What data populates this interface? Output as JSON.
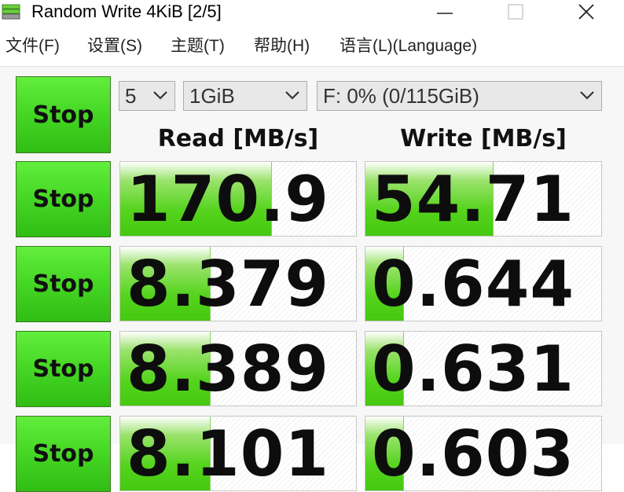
{
  "window": {
    "title": "Random Write 4KiB [2/5]"
  },
  "menu": [
    {
      "label": "文件(F)"
    },
    {
      "label": "设置(S)"
    },
    {
      "label": "主题(T)"
    },
    {
      "label": "帮助(H)"
    },
    {
      "label": "语言(L)(Language)"
    }
  ],
  "controls": {
    "all_label": "Stop",
    "count": "5",
    "size": "1GiB",
    "drive": "F: 0% (0/115GiB)"
  },
  "columns": {
    "read": "Read [MB/s]",
    "write": "Write [MB/s]"
  },
  "rows": [
    {
      "button": "Stop",
      "read": "170.9",
      "read_fill": 0.64,
      "write": "54.71",
      "write_fill": 0.54
    },
    {
      "button": "Stop",
      "read": "8.379",
      "read_fill": 0.38,
      "write": "0.644",
      "write_fill": 0.16
    },
    {
      "button": "Stop",
      "read": "8.389",
      "read_fill": 0.38,
      "write": "0.631",
      "write_fill": 0.16
    },
    {
      "button": "Stop",
      "read": "8.101",
      "read_fill": 0.38,
      "write": "0.603",
      "write_fill": 0.16
    }
  ],
  "colors": {
    "button_green": "#45d624",
    "bar_green": "#56d41e",
    "border": "#c6c6c6"
  }
}
